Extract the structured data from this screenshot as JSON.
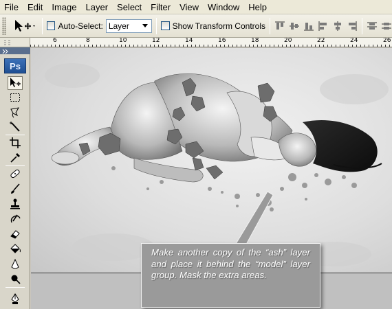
{
  "app": {
    "name": "Adobe Photoshop",
    "logo_text": "Ps"
  },
  "menubar": {
    "items": [
      "File",
      "Edit",
      "Image",
      "Layer",
      "Select",
      "Filter",
      "View",
      "Window",
      "Help"
    ]
  },
  "options": {
    "auto_select_label": "Auto-Select:",
    "auto_select_checked": false,
    "auto_select_value": "Layer",
    "show_transform_label": "Show Transform Controls",
    "show_transform_checked": false
  },
  "ruler": {
    "top_labels": [
      "6",
      "8",
      "10",
      "12",
      "14",
      "16",
      "18",
      "20",
      "22",
      "24",
      "26"
    ]
  },
  "toolbox": {
    "tools": [
      {
        "name": "move-tool",
        "icon": "move-icon",
        "active": true
      },
      {
        "name": "marquee-tool",
        "icon": "rect-marquee-icon"
      },
      {
        "name": "lasso-tool",
        "icon": "lasso-icon"
      },
      {
        "name": "quick-selection-tool",
        "icon": "magic-wand-icon"
      },
      {
        "name": "crop-tool",
        "icon": "crop-icon"
      },
      {
        "name": "eyedropper-tool",
        "icon": "eyedropper-icon"
      },
      {
        "name": "healing-brush-tool",
        "icon": "bandage-icon"
      },
      {
        "name": "brush-tool",
        "icon": "brush-icon"
      },
      {
        "name": "clone-stamp-tool",
        "icon": "stamp-icon"
      },
      {
        "name": "history-brush-tool",
        "icon": "history-brush-icon"
      },
      {
        "name": "eraser-tool",
        "icon": "eraser-icon"
      },
      {
        "name": "paint-bucket-tool",
        "icon": "paint-bucket-icon"
      },
      {
        "name": "blur-tool",
        "icon": "blur-icon"
      },
      {
        "name": "dodge-tool",
        "icon": "dodge-icon"
      },
      {
        "name": "pen-tool",
        "icon": "pen-icon"
      }
    ]
  },
  "callout": {
    "text": "Make another copy of the “ash” layer and place it behind the “model” layer group. Mask the extra areas."
  },
  "colors": {
    "menu_bg": "#ece9d8",
    "ps_logo": "#2a5ea6",
    "callout_bg": "#9a9a9a",
    "pasteboard": "#c0c0c0"
  }
}
